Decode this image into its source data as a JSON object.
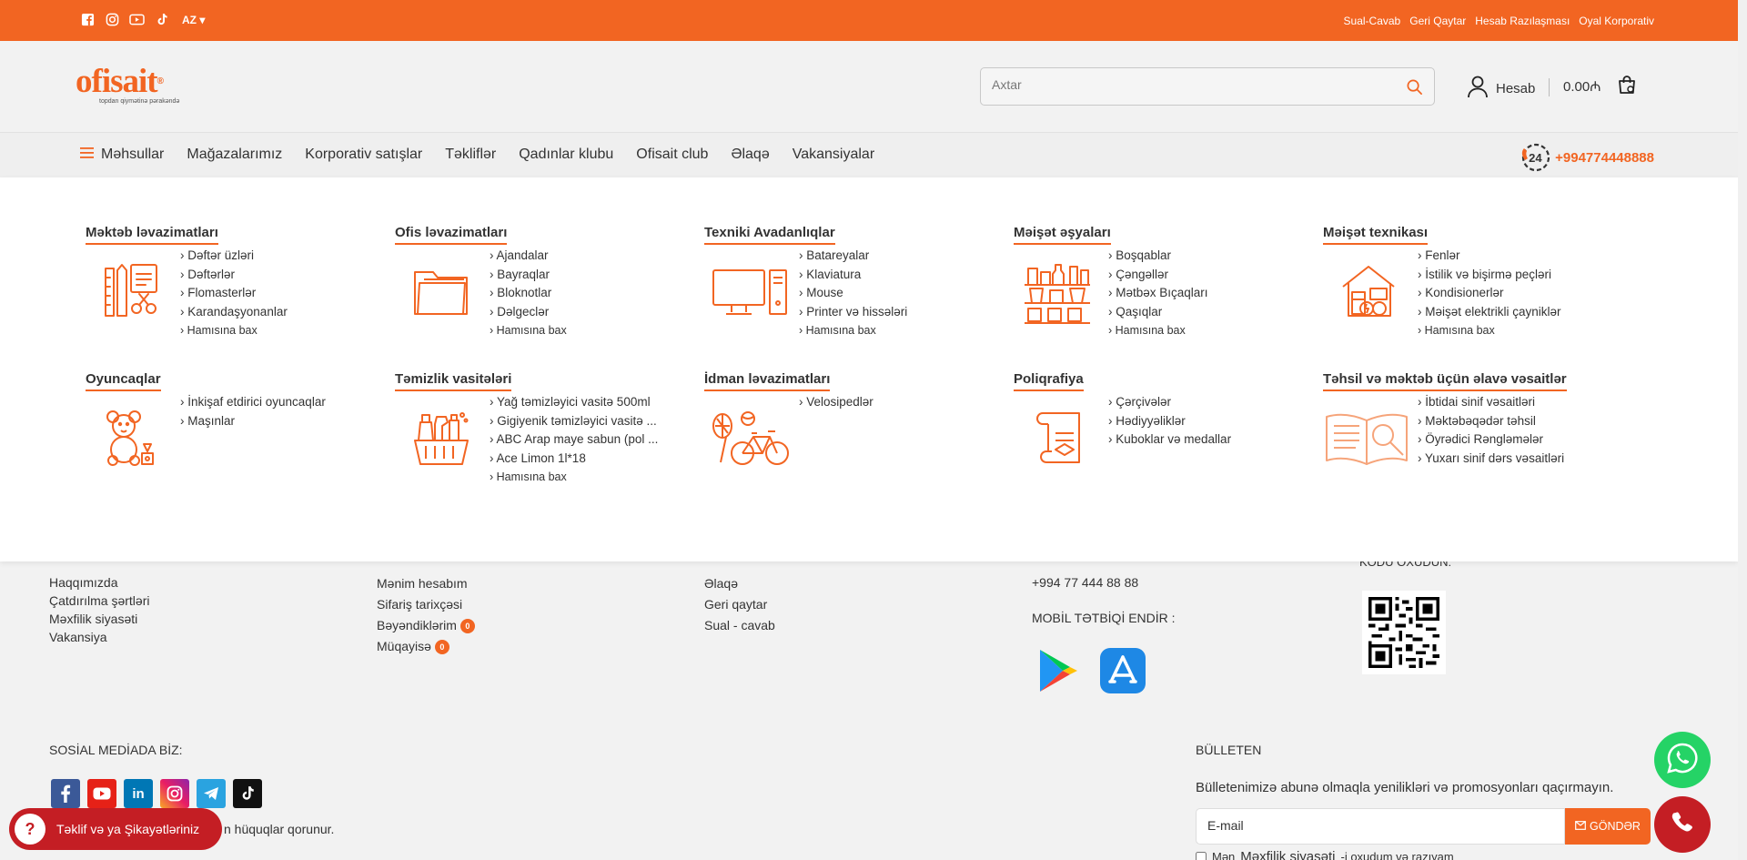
{
  "topbar": {
    "lang": "AZ",
    "links": [
      "Sual-Cavab",
      "Geri Qaytar",
      "Hesab Razılaşması",
      "Oyal Korporativ"
    ]
  },
  "header": {
    "logo": "ofisait",
    "logo_mark": "®",
    "logo_tagline": "topdan qiymətinə pərakəndə",
    "search_placeholder": "Axtar",
    "account_label": "Hesab",
    "cart_total": "0.00₼"
  },
  "nav": {
    "products": "Məhsullar",
    "items": [
      "Mağazalarımız",
      "Korporativ satışlar",
      "Təkliflər",
      "Qadınlar klubu",
      "Ofisait club",
      "Əlaqə",
      "Vakansiyalar"
    ],
    "phone_badge": "24",
    "phone": "+994774448888"
  },
  "categories": [
    {
      "title": "Məktəb ləvazimatları",
      "icon": "school-supplies-icon",
      "links": [
        "Dəftər üzləri",
        "Dəftərlər",
        "Flomasterlər",
        "Karandaşyonanlar"
      ],
      "more": "Hamısına bax"
    },
    {
      "title": "Ofis ləvazimatları",
      "icon": "folder-icon",
      "links": [
        "Ajandalar",
        "Bayraqlar",
        "Bloknotlar",
        "Dəlgeclər"
      ],
      "more": "Hamısına bax"
    },
    {
      "title": "Texniki Avadanlıqlar",
      "icon": "computer-icon",
      "links": [
        "Batareyalar",
        "Klaviatura",
        "Mouse",
        "Printer və hissələri"
      ],
      "more": "Hamısına bax"
    },
    {
      "title": "Məişət əşyaları",
      "icon": "kitchen-shelf-icon",
      "links": [
        "Boşqablar",
        "Çəngəllər",
        "Mətbəx Bıçaqları",
        "Qaşıqlar"
      ],
      "more": "Hamısına bax"
    },
    {
      "title": "Məişət texnikası",
      "icon": "home-appliance-icon",
      "links": [
        "Fenlər",
        "İstilik və bişirmə peçləri",
        "Kondisionerlər",
        "Məişət elektrikli çayniklər"
      ],
      "more": "Hamısına bax"
    },
    {
      "title": "Oyuncaqlar",
      "icon": "teddy-bear-icon",
      "links": [
        "İnkişaf etdirici oyuncaqlar",
        "Maşınlar"
      ],
      "more": ""
    },
    {
      "title": "Təmizlik vasitələri",
      "icon": "cleaning-basket-icon",
      "links": [
        "Yağ təmizləyici vasitə 500ml",
        "Gigiyenik təmizləyici vasitə ...",
        "ABC Arap maye sabun (pol ...",
        "Ace Limon 1l*18"
      ],
      "more": "Hamısına bax"
    },
    {
      "title": "İdman ləvazimatları",
      "icon": "sport-bicycle-icon",
      "links": [
        "Velosipedlər"
      ],
      "more": ""
    },
    {
      "title": "Poliqrafiya",
      "icon": "scroll-print-icon",
      "links": [
        "Çərçivələr",
        "Hədiyyəliklər",
        "Kuboklar və medallar"
      ],
      "more": ""
    },
    {
      "title": "Təhsil və məktəb üçün əlavə vəsaitlər",
      "icon": "open-book-icon",
      "links": [
        "İbtidai sinif vəsaitləri",
        "Məktəbəqədər təhsil",
        "Öyrədici Rənglәmələr",
        "Yuxarı sinif dərs vəsaitləri"
      ],
      "more": ""
    }
  ],
  "footer": {
    "col1": [
      "Haqqımızda",
      "Çatdırılma şərtləri",
      "Məxfilik siyasəti",
      "Vakansiya"
    ],
    "col2": [
      "Mənim hesabım",
      "Sifariş tarixçəsi",
      "Bəyəndiklərim",
      "Müqayisə"
    ],
    "col2_badges": [
      "0",
      "0"
    ],
    "col3": [
      "Əlaqə",
      "Geri qaytar",
      "Sual - cavab"
    ],
    "phone": "+994 77 444 88 88",
    "app_title": "MOBİL TƏTBİQİ ENDİR :",
    "qr_title": "KODU OXUDUN:",
    "social_title": "SOSİAL MEDİADA BİZ:",
    "rights": "n hüquqlar qorunur.",
    "bulletin_title": "BÜLLETEN",
    "bulletin_desc": "Bülletenimizə abunə olmaqla yenilikləri və promosyonları qaçırmayın.",
    "email_placeholder": "E-mail",
    "send_label": "GÖNDƏR",
    "consent_pre": "Mən",
    "consent_link": "Məxfilik siyasəti",
    "consent_post": "-i oxudum və razıyam"
  },
  "feedback_label": "Təklif və ya Şikayətləriniz",
  "colors": {
    "brand": "#f26522",
    "red": "#c41e24",
    "whatsapp": "#25d366"
  }
}
